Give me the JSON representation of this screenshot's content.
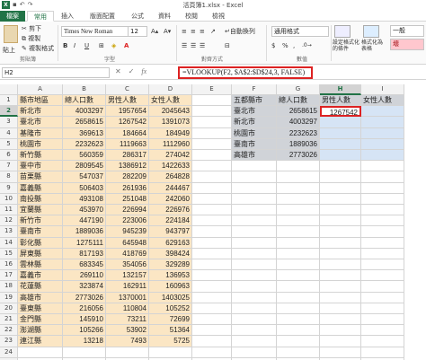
{
  "window": {
    "title": "活頁簿1.xlsx - Excel"
  },
  "tabs": [
    "檔案",
    "常用",
    "插入",
    "版面配置",
    "公式",
    "資料",
    "校閱",
    "檢視"
  ],
  "ribbon": {
    "paste_label": "貼上",
    "cut": "剪下",
    "copy": "複製",
    "format_painter": "複製格式",
    "clipboard_group": "剪貼簿",
    "font_name": "Times New Roman",
    "font_size": "12",
    "bold": "B",
    "italic": "I",
    "underline": "U",
    "font_group": "字型",
    "align_group": "對齊方式",
    "wrap_text": "自動換列",
    "number_format": "通用格式",
    "number_group": "數值",
    "cond_format": "設定格式化的條件",
    "table_format": "格式化為表格",
    "style_normal": "一般",
    "style_bad": "壞"
  },
  "formula_bar": {
    "name_box": "H2",
    "formula": "=VLOOKUP(F2, $A$2:$D$24,3, FALSE)",
    "fx": "fx"
  },
  "columns": [
    "A",
    "B",
    "C",
    "D",
    "E",
    "F",
    "G",
    "H",
    "I"
  ],
  "rows": [
    "1",
    "2",
    "3",
    "4",
    "5",
    "6",
    "7",
    "8",
    "9",
    "10",
    "11",
    "12",
    "13",
    "14",
    "15",
    "16",
    "17",
    "18",
    "19",
    "20",
    "21",
    "22",
    "23",
    "24",
    "25"
  ],
  "left_table": {
    "headers": [
      "縣市地區",
      "總人口數",
      "男性人數",
      "女性人數"
    ],
    "rows": [
      [
        "新北市",
        "4003297",
        "1957654",
        "2045643"
      ],
      [
        "臺北市",
        "2658615",
        "1267542",
        "1391073"
      ],
      [
        "基隆市",
        "369613",
        "184664",
        "184949"
      ],
      [
        "桃園市",
        "2232623",
        "1119663",
        "1112960"
      ],
      [
        "新竹縣",
        "560359",
        "286317",
        "274042"
      ],
      [
        "臺中市",
        "2809545",
        "1386912",
        "1422633"
      ],
      [
        "苗栗縣",
        "547037",
        "282209",
        "264828"
      ],
      [
        "嘉義縣",
        "506403",
        "261936",
        "244467"
      ],
      [
        "南投縣",
        "493108",
        "251048",
        "242060"
      ],
      [
        "宜蘭縣",
        "453970",
        "226994",
        "226976"
      ],
      [
        "新竹市",
        "447190",
        "223006",
        "224184"
      ],
      [
        "臺南市",
        "1889036",
        "945239",
        "943797"
      ],
      [
        "彰化縣",
        "1275111",
        "645948",
        "629163"
      ],
      [
        "屏東縣",
        "817193",
        "418769",
        "398424"
      ],
      [
        "雲林縣",
        "683345",
        "354056",
        "329289"
      ],
      [
        "嘉義市",
        "269110",
        "132157",
        "136953"
      ],
      [
        "花蓮縣",
        "323874",
        "162911",
        "160963"
      ],
      [
        "高雄市",
        "2773026",
        "1370001",
        "1403025"
      ],
      [
        "臺東縣",
        "216056",
        "110804",
        "105252"
      ],
      [
        "金門縣",
        "145910",
        "73211",
        "72699"
      ],
      [
        "澎湖縣",
        "105266",
        "53902",
        "51364"
      ],
      [
        "連江縣",
        "13218",
        "7493",
        "5725"
      ]
    ]
  },
  "right_table": {
    "headers": [
      "五都縣市",
      "總人口數",
      "男性人數",
      "女性人數"
    ],
    "rows": [
      [
        "臺北市",
        "2658615",
        "1267542",
        ""
      ],
      [
        "新北市",
        "4003297",
        "",
        ""
      ],
      [
        "桃園市",
        "2232623",
        "",
        ""
      ],
      [
        "臺南市",
        "1889036",
        "",
        ""
      ],
      [
        "高雄市",
        "2773026",
        "",
        ""
      ]
    ]
  }
}
